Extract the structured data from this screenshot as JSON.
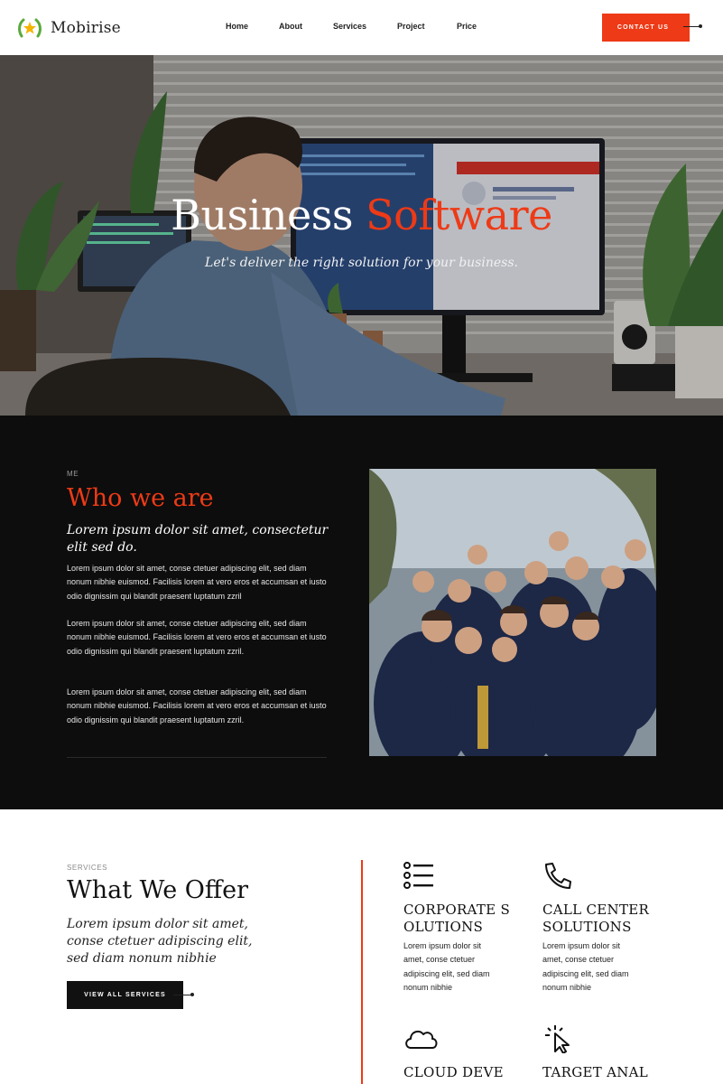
{
  "header": {
    "brand": "Mobirise",
    "nav": [
      "Home",
      "About",
      "Services",
      "Project",
      "Price"
    ],
    "cta_label": "CONTACT US"
  },
  "hero": {
    "title_part1": "Business",
    "title_part2": "Software",
    "subtitle": "Let's deliver the right solution for your business."
  },
  "about": {
    "kicker": "ME",
    "title": "Who we are",
    "lead": "Lorem ipsum dolor sit amet, consectetur elit sed do.",
    "paragraphs": [
      "Lorem ipsum dolor sit amet, conse ctetuer adipiscing elit, sed diam nonum nibhie euismod. Facilisis lorem at vero eros et accumsan et iusto odio dignissim qui blandit praesent luptatum zzril",
      "Lorem ipsum dolor sit amet, conse ctetuer adipiscing elit, sed diam nonum nibhie euismod. Facilisis lorem at vero eros et accumsan et iusto odio dignissim qui blandit praesent luptatum zzril.",
      "Lorem ipsum dolor sit amet, conse ctetuer adipiscing elit, sed diam nonum nibhie euismod. Facilisis lorem at vero eros et accumsan et iusto odio dignissim qui blandit praesent luptatum zzril."
    ]
  },
  "services": {
    "kicker": "SERVICES",
    "title": "What We Offer",
    "lead": "Lorem ipsum dolor sit amet, conse ctetuer adipiscing elit, sed diam nonum nibhie",
    "button_label": "VIEW ALL SERVICES",
    "cards": [
      {
        "icon": "list-icon",
        "title": "CORPORATE SOLUTIONS",
        "text": "Lorem ipsum dolor sit amet, conse ctetuer adipiscing elit, sed diam nonum nibhie"
      },
      {
        "icon": "phone-icon",
        "title": "CALL CENTER SOLUTIONS",
        "text": "Lorem ipsum dolor sit amet, conse ctetuer adipiscing elit, sed diam nonum nibhie"
      },
      {
        "icon": "cloud-icon",
        "title": "CLOUD DEVELOPMENT",
        "text": ""
      },
      {
        "icon": "cursor-click-icon",
        "title": "TARGET ANALYSIS",
        "text": ""
      }
    ]
  },
  "colors": {
    "accent": "#ee3a16",
    "dark_section": "#0d0d0d",
    "text_dark": "#111111"
  }
}
